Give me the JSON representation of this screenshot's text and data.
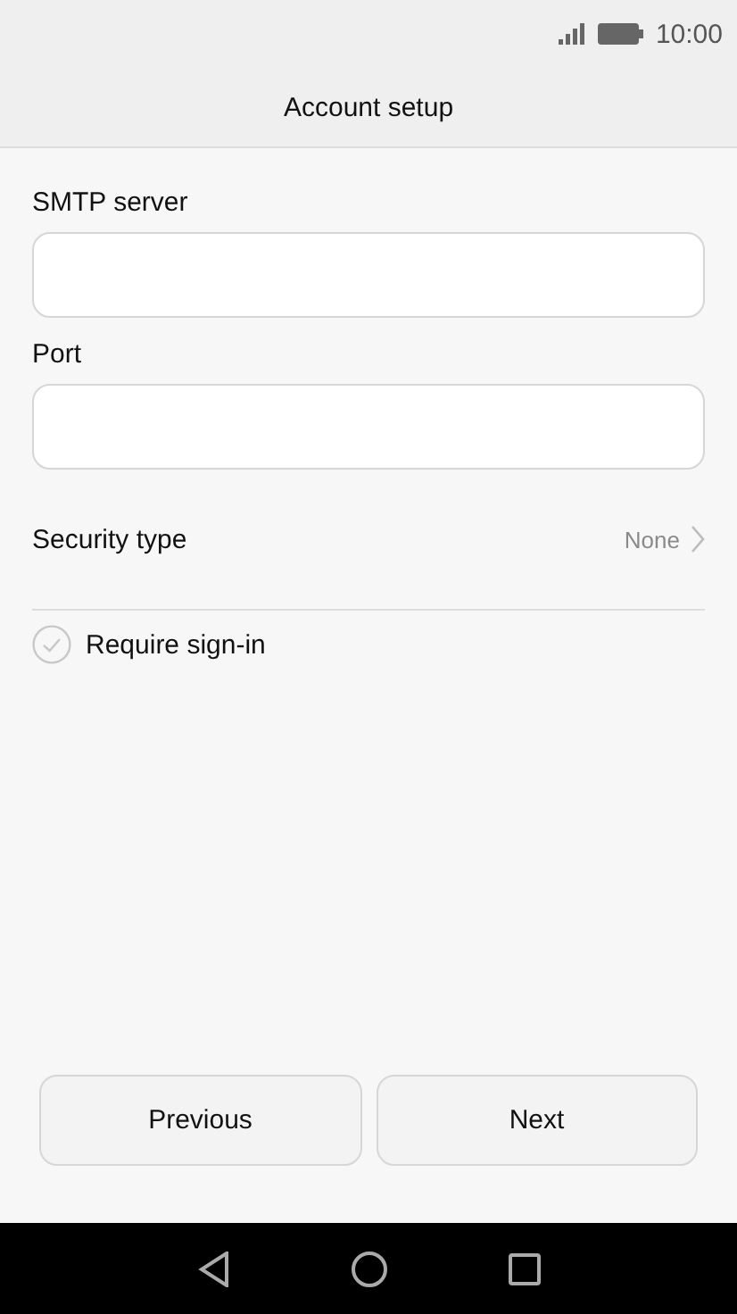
{
  "status_bar": {
    "time": "10:00"
  },
  "header": {
    "title": "Account setup"
  },
  "fields": [
    {
      "label": "SMTP server"
    },
    {
      "label": "Port"
    }
  ],
  "security": {
    "label": "Security type",
    "value": "None"
  },
  "require_sign_in": {
    "label": "Require sign-in",
    "checked": false
  },
  "buttons": [
    {
      "label": "Previous"
    },
    {
      "label": "Next"
    }
  ]
}
